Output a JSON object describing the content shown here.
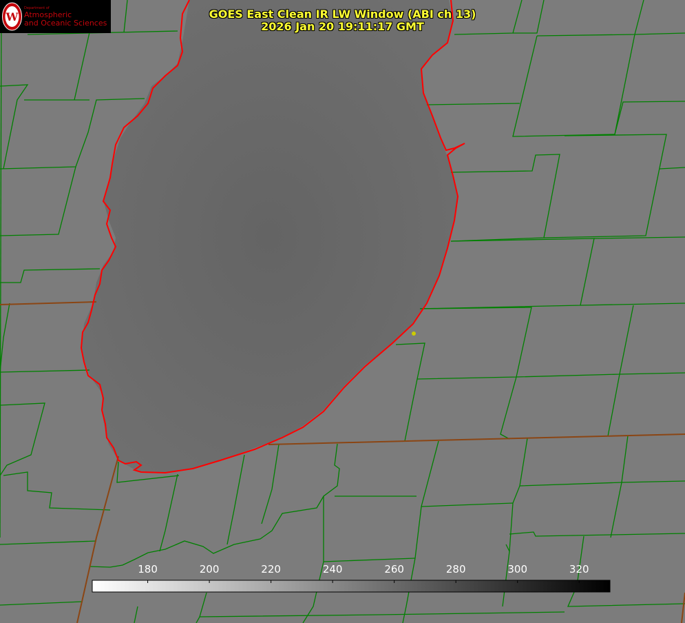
{
  "title_line1": "GOES East Clean IR LW Window (ABI ch 13)",
  "title_line2": "2026 Jan 20 19:11:17 GMT",
  "logo": {
    "dept": "Department of",
    "line1": "Atmospheric",
    "line2": "and Oceanic Sciences",
    "seal_letter": "W"
  },
  "colors": {
    "land": "#7c7c7c",
    "lake": "#686868",
    "county_lines": "#008000",
    "state_lines": "#8b4513",
    "coastline": "#ff0000",
    "marker": "#cccc00",
    "title": "#ffff33"
  },
  "colorbar": {
    "ticks": [
      "180",
      "200",
      "220",
      "240",
      "260",
      "280",
      "300",
      "320"
    ],
    "tick_values": [
      180,
      200,
      220,
      240,
      260,
      280,
      300,
      320
    ],
    "range": [
      162,
      330
    ],
    "gradient": "white to black"
  }
}
